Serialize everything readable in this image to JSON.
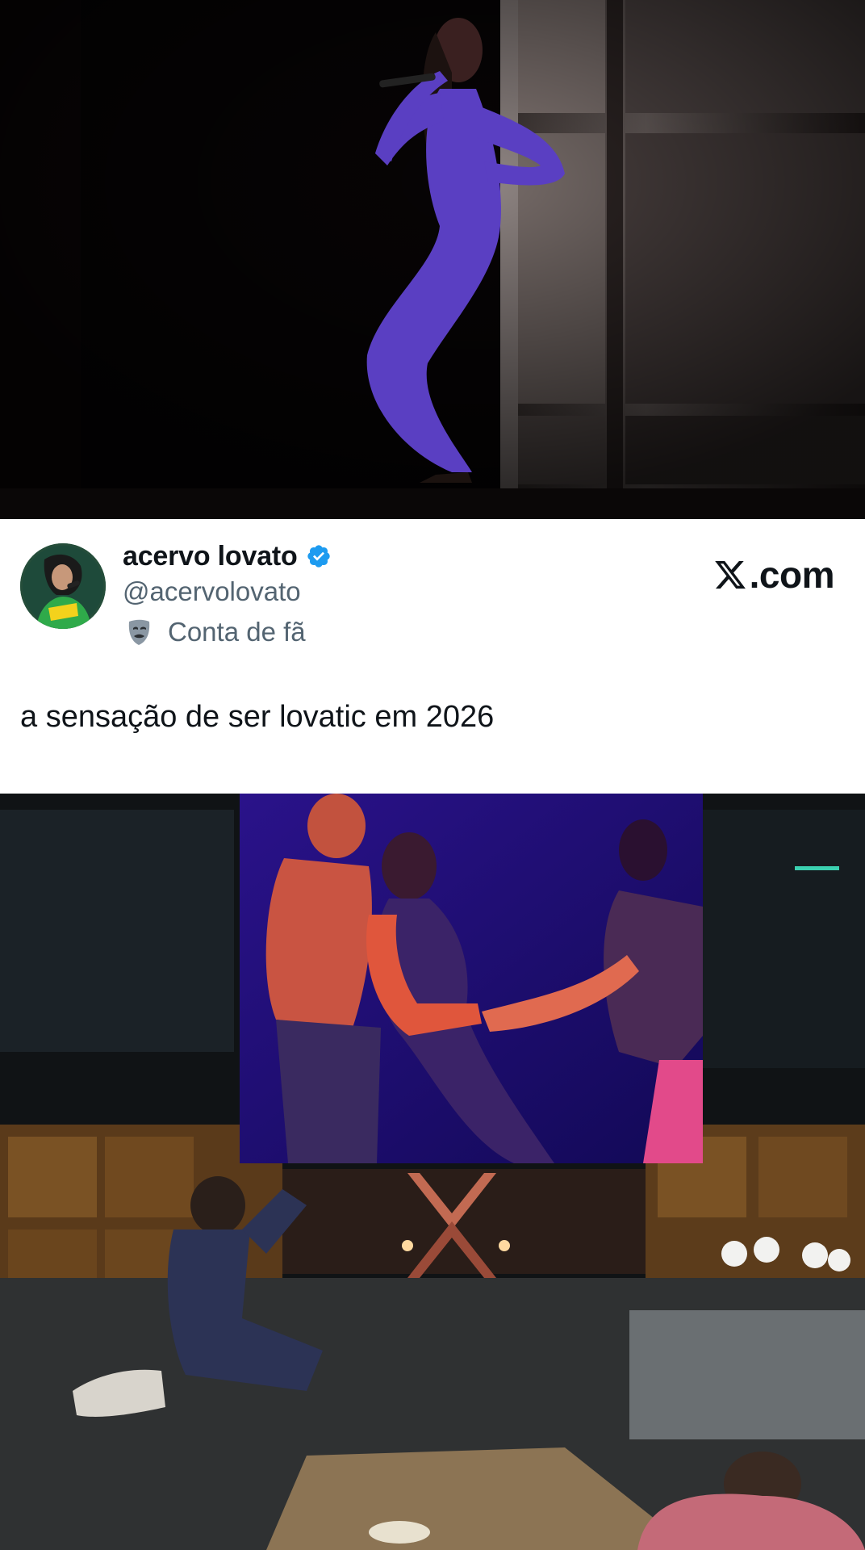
{
  "top_image": {
    "description_icon": "stage-performer-photo"
  },
  "tweet": {
    "display_name": "acervo lovato",
    "handle": "@acervolovato",
    "fan_label": "Conta de fã",
    "text": "a sensação de ser lovatic em 2026",
    "verified": true,
    "brand": {
      "domain": ".com"
    },
    "colors": {
      "name": "#0f1419",
      "secondary": "#536471",
      "verified": "#1d9bf0"
    }
  },
  "icons": {
    "verified": "verified-badge-icon",
    "mask": "theater-mask-icon",
    "x_logo": "x-logo-icon"
  }
}
